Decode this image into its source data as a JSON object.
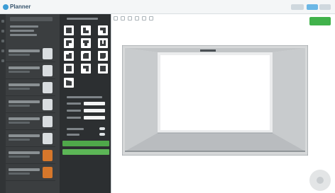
{
  "app": {
    "name": "Planner"
  },
  "colors": {
    "accent": "#ee7d22",
    "primary_action": "#4fa84a",
    "brand": "#3c9dd6"
  },
  "icons": {
    "logo": "logo-icon",
    "zoom": "zoom-control-icon"
  }
}
